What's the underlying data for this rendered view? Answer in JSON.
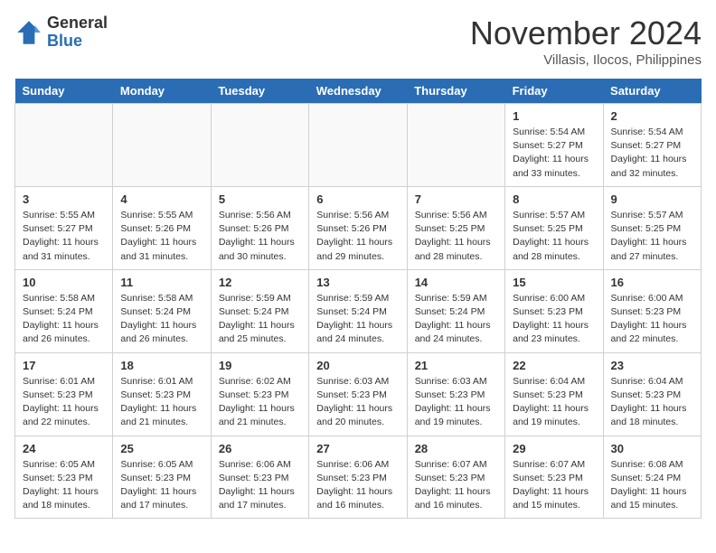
{
  "header": {
    "logo_general": "General",
    "logo_blue": "Blue",
    "month_title": "November 2024",
    "location": "Villasis, Ilocos, Philippines"
  },
  "weekdays": [
    "Sunday",
    "Monday",
    "Tuesday",
    "Wednesday",
    "Thursday",
    "Friday",
    "Saturday"
  ],
  "weeks": [
    [
      {
        "day": "",
        "info": ""
      },
      {
        "day": "",
        "info": ""
      },
      {
        "day": "",
        "info": ""
      },
      {
        "day": "",
        "info": ""
      },
      {
        "day": "",
        "info": ""
      },
      {
        "day": "1",
        "info": "Sunrise: 5:54 AM\nSunset: 5:27 PM\nDaylight: 11 hours\nand 33 minutes."
      },
      {
        "day": "2",
        "info": "Sunrise: 5:54 AM\nSunset: 5:27 PM\nDaylight: 11 hours\nand 32 minutes."
      }
    ],
    [
      {
        "day": "3",
        "info": "Sunrise: 5:55 AM\nSunset: 5:27 PM\nDaylight: 11 hours\nand 31 minutes."
      },
      {
        "day": "4",
        "info": "Sunrise: 5:55 AM\nSunset: 5:26 PM\nDaylight: 11 hours\nand 31 minutes."
      },
      {
        "day": "5",
        "info": "Sunrise: 5:56 AM\nSunset: 5:26 PM\nDaylight: 11 hours\nand 30 minutes."
      },
      {
        "day": "6",
        "info": "Sunrise: 5:56 AM\nSunset: 5:26 PM\nDaylight: 11 hours\nand 29 minutes."
      },
      {
        "day": "7",
        "info": "Sunrise: 5:56 AM\nSunset: 5:25 PM\nDaylight: 11 hours\nand 28 minutes."
      },
      {
        "day": "8",
        "info": "Sunrise: 5:57 AM\nSunset: 5:25 PM\nDaylight: 11 hours\nand 28 minutes."
      },
      {
        "day": "9",
        "info": "Sunrise: 5:57 AM\nSunset: 5:25 PM\nDaylight: 11 hours\nand 27 minutes."
      }
    ],
    [
      {
        "day": "10",
        "info": "Sunrise: 5:58 AM\nSunset: 5:24 PM\nDaylight: 11 hours\nand 26 minutes."
      },
      {
        "day": "11",
        "info": "Sunrise: 5:58 AM\nSunset: 5:24 PM\nDaylight: 11 hours\nand 26 minutes."
      },
      {
        "day": "12",
        "info": "Sunrise: 5:59 AM\nSunset: 5:24 PM\nDaylight: 11 hours\nand 25 minutes."
      },
      {
        "day": "13",
        "info": "Sunrise: 5:59 AM\nSunset: 5:24 PM\nDaylight: 11 hours\nand 24 minutes."
      },
      {
        "day": "14",
        "info": "Sunrise: 5:59 AM\nSunset: 5:24 PM\nDaylight: 11 hours\nand 24 minutes."
      },
      {
        "day": "15",
        "info": "Sunrise: 6:00 AM\nSunset: 5:23 PM\nDaylight: 11 hours\nand 23 minutes."
      },
      {
        "day": "16",
        "info": "Sunrise: 6:00 AM\nSunset: 5:23 PM\nDaylight: 11 hours\nand 22 minutes."
      }
    ],
    [
      {
        "day": "17",
        "info": "Sunrise: 6:01 AM\nSunset: 5:23 PM\nDaylight: 11 hours\nand 22 minutes."
      },
      {
        "day": "18",
        "info": "Sunrise: 6:01 AM\nSunset: 5:23 PM\nDaylight: 11 hours\nand 21 minutes."
      },
      {
        "day": "19",
        "info": "Sunrise: 6:02 AM\nSunset: 5:23 PM\nDaylight: 11 hours\nand 21 minutes."
      },
      {
        "day": "20",
        "info": "Sunrise: 6:03 AM\nSunset: 5:23 PM\nDaylight: 11 hours\nand 20 minutes."
      },
      {
        "day": "21",
        "info": "Sunrise: 6:03 AM\nSunset: 5:23 PM\nDaylight: 11 hours\nand 19 minutes."
      },
      {
        "day": "22",
        "info": "Sunrise: 6:04 AM\nSunset: 5:23 PM\nDaylight: 11 hours\nand 19 minutes."
      },
      {
        "day": "23",
        "info": "Sunrise: 6:04 AM\nSunset: 5:23 PM\nDaylight: 11 hours\nand 18 minutes."
      }
    ],
    [
      {
        "day": "24",
        "info": "Sunrise: 6:05 AM\nSunset: 5:23 PM\nDaylight: 11 hours\nand 18 minutes."
      },
      {
        "day": "25",
        "info": "Sunrise: 6:05 AM\nSunset: 5:23 PM\nDaylight: 11 hours\nand 17 minutes."
      },
      {
        "day": "26",
        "info": "Sunrise: 6:06 AM\nSunset: 5:23 PM\nDaylight: 11 hours\nand 17 minutes."
      },
      {
        "day": "27",
        "info": "Sunrise: 6:06 AM\nSunset: 5:23 PM\nDaylight: 11 hours\nand 16 minutes."
      },
      {
        "day": "28",
        "info": "Sunrise: 6:07 AM\nSunset: 5:23 PM\nDaylight: 11 hours\nand 16 minutes."
      },
      {
        "day": "29",
        "info": "Sunrise: 6:07 AM\nSunset: 5:23 PM\nDaylight: 11 hours\nand 15 minutes."
      },
      {
        "day": "30",
        "info": "Sunrise: 6:08 AM\nSunset: 5:24 PM\nDaylight: 11 hours\nand 15 minutes."
      }
    ]
  ]
}
